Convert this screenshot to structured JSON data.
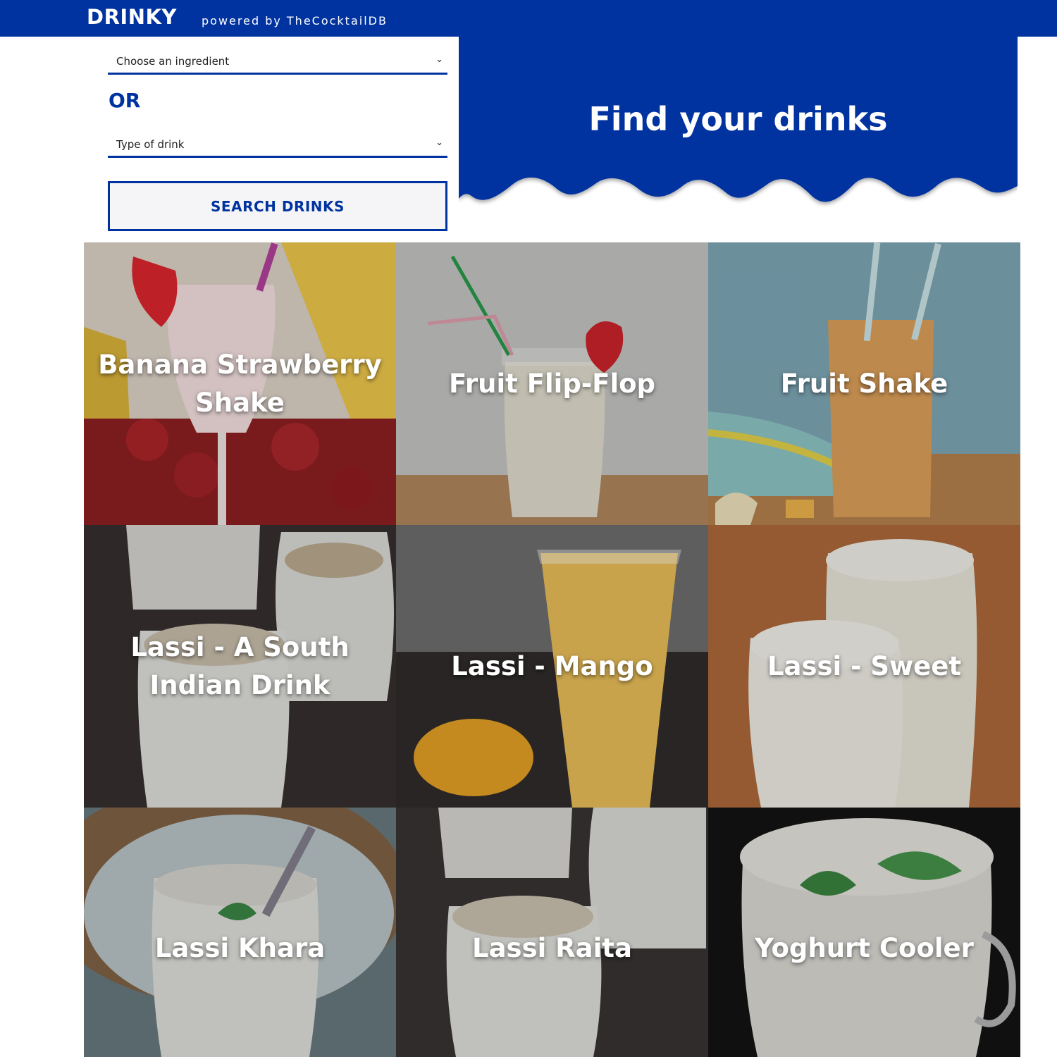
{
  "header": {
    "brand": "DRINKY",
    "powered_by": "powered by TheCocktailDB",
    "background_color": "#0033a0"
  },
  "filters": {
    "ingredient_select": {
      "value": "Choose an ingredient",
      "icon": "chevron-down-icon"
    },
    "or_label": "OR",
    "type_select": {
      "value": "Type of drink",
      "icon": "chevron-down-icon"
    },
    "search_button": "SEARCH DRINKS"
  },
  "hero": {
    "title": "Find your drinks",
    "color": "#0033a0"
  },
  "drinks": [
    {
      "name": "Banana Strawberry Shake"
    },
    {
      "name": "Fruit Flip-Flop"
    },
    {
      "name": "Fruit Shake"
    },
    {
      "name": "Lassi - A South Indian Drink"
    },
    {
      "name": "Lassi - Mango"
    },
    {
      "name": "Lassi - Sweet"
    },
    {
      "name": "Lassi Khara"
    },
    {
      "name": "Lassi Raita"
    },
    {
      "name": "Yoghurt Cooler"
    }
  ]
}
